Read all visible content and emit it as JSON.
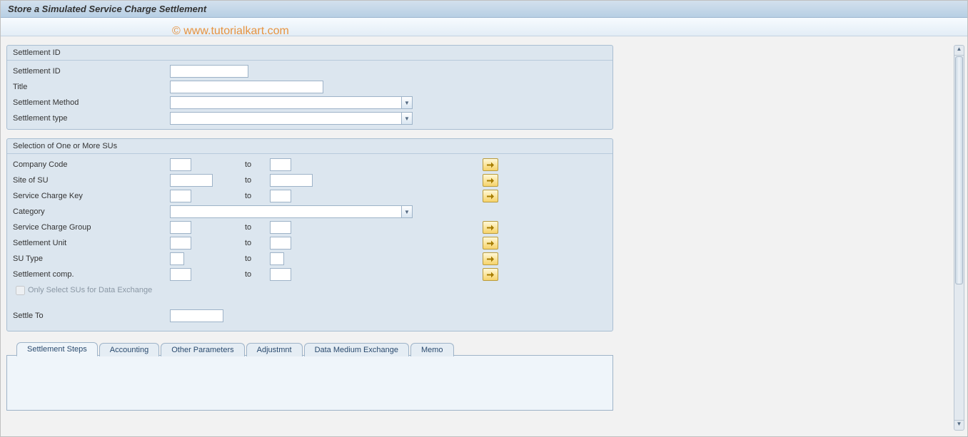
{
  "header": {
    "title": "Store a Simulated Service Charge Settlement"
  },
  "watermark": "© www.tutorialkart.com",
  "panel1": {
    "title": "Settlement ID",
    "settlement_id_label": "Settlement ID",
    "title_label": "Title",
    "method_label": "Settlement Method",
    "type_label": "Settlement type"
  },
  "panel2": {
    "title": "Selection of One or More SUs",
    "company_code_label": "Company Code",
    "site_label": "Site of SU",
    "key_label": "Service Charge Key",
    "category_label": "Category",
    "group_label": "Service Charge Group",
    "unit_label": "Settlement Unit",
    "su_type_label": "SU Type",
    "comp_label": "Settlement comp.",
    "to_label": "to",
    "only_select_label": "Only Select SUs for Data Exchange",
    "settle_to_label": "Settle To"
  },
  "tabs": [
    {
      "label": "Settlement Steps"
    },
    {
      "label": "Accounting"
    },
    {
      "label": "Other Parameters"
    },
    {
      "label": "Adjustmnt"
    },
    {
      "label": "Data Medium Exchange"
    },
    {
      "label": "Memo"
    }
  ]
}
